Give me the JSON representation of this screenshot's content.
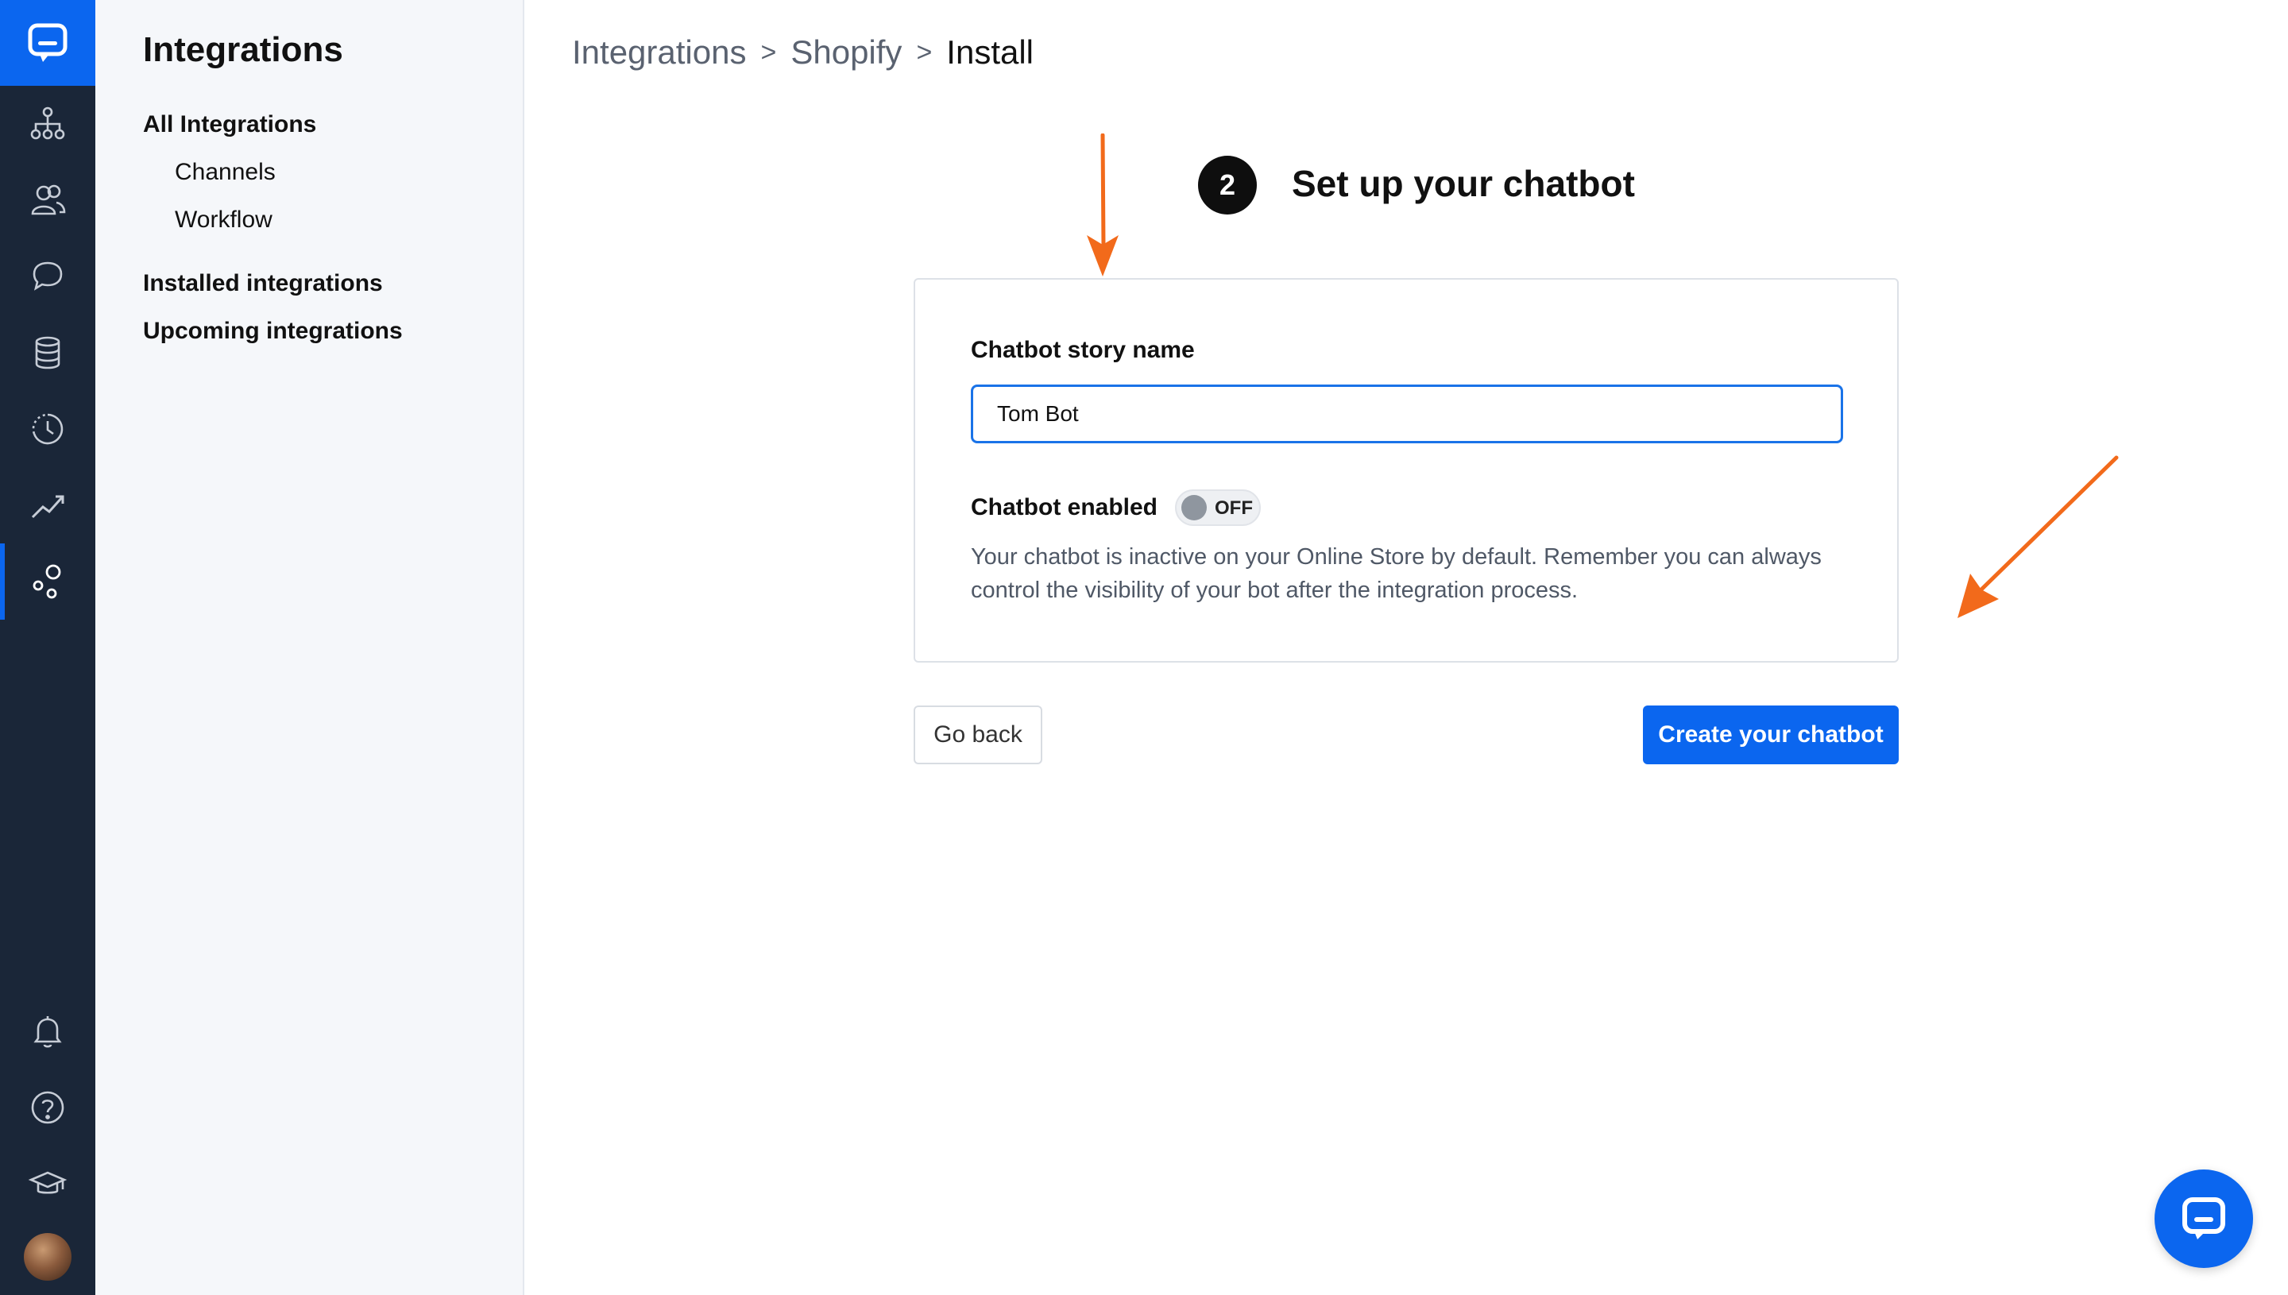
{
  "rail": {
    "items": [
      {
        "name": "org-chart-icon"
      },
      {
        "name": "customers-icon"
      },
      {
        "name": "chats-icon"
      },
      {
        "name": "archives-icon"
      },
      {
        "name": "history-icon"
      },
      {
        "name": "reports-icon"
      },
      {
        "name": "integrations-icon"
      }
    ],
    "active": "integrations-icon",
    "bottom_items": [
      {
        "name": "notifications-icon"
      },
      {
        "name": "help-icon"
      },
      {
        "name": "academy-icon"
      }
    ],
    "accent_color": "#0b66ef",
    "background_color": "#1a2638"
  },
  "sidebar": {
    "title": "Integrations",
    "items": [
      {
        "label": "All Integrations"
      },
      {
        "label": "Channels"
      },
      {
        "label": "Workflow"
      },
      {
        "label": "Installed integrations"
      },
      {
        "label": "Upcoming integrations"
      }
    ]
  },
  "breadcrumb": {
    "items": [
      "Integrations",
      "Shopify",
      "Install"
    ],
    "separator": ">"
  },
  "step": {
    "number": "2",
    "title": "Set up your chatbot"
  },
  "form": {
    "name_label": "Chatbot story name",
    "name_value": "Tom Bot",
    "enabled_label": "Chatbot enabled",
    "toggle_state": "OFF",
    "help_text": "Your chatbot is inactive on your Online Store by default. Remember you can always control the visibility of your bot after the integration process."
  },
  "actions": {
    "back_label": "Go back",
    "create_label": "Create your chatbot",
    "primary_color": "#0b66ef"
  },
  "annotations": {
    "arrow_color": "#f26a1b"
  }
}
